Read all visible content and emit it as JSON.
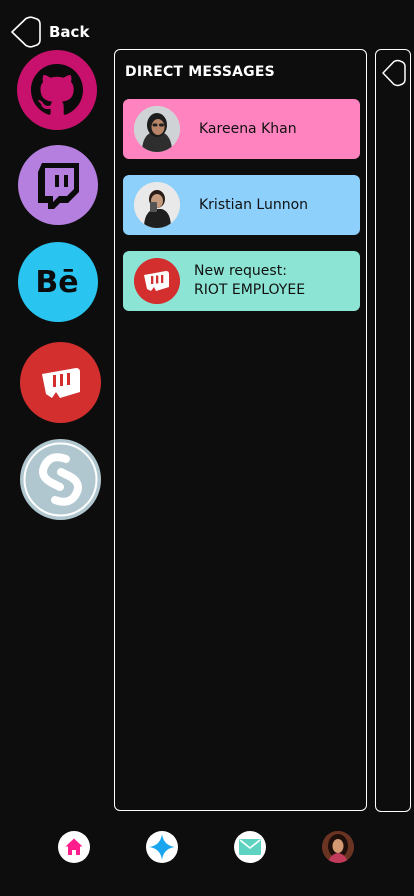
{
  "header": {
    "back_label": "Back"
  },
  "apps": [
    {
      "name": "github-icon",
      "color": "#c8116d"
    },
    {
      "name": "twitch-icon",
      "color": "#b57fe0"
    },
    {
      "name": "behance-icon",
      "color": "#29c4ef"
    },
    {
      "name": "riot-icon",
      "color": "#d32f2f"
    },
    {
      "name": "shazam-icon",
      "color": "#b0c7cf"
    }
  ],
  "dm": {
    "title": "DIRECT MESSAGES",
    "cards": [
      {
        "name": "Kareena Khan",
        "color": "#ff83bf"
      },
      {
        "name": "Kristian Lunnon",
        "color": "#8ed0fc"
      },
      {
        "line1": "New request:",
        "line2": "RIOT EMPLOYEE",
        "color": "#8ce5d4"
      }
    ]
  },
  "nav": {
    "items": [
      "home-icon",
      "explore-star-icon",
      "mail-icon",
      "profile-avatar"
    ],
    "colors": {
      "home": "#ff1e8c",
      "explore": "#1aa6ee",
      "mail": "#5fd3c2"
    }
  }
}
